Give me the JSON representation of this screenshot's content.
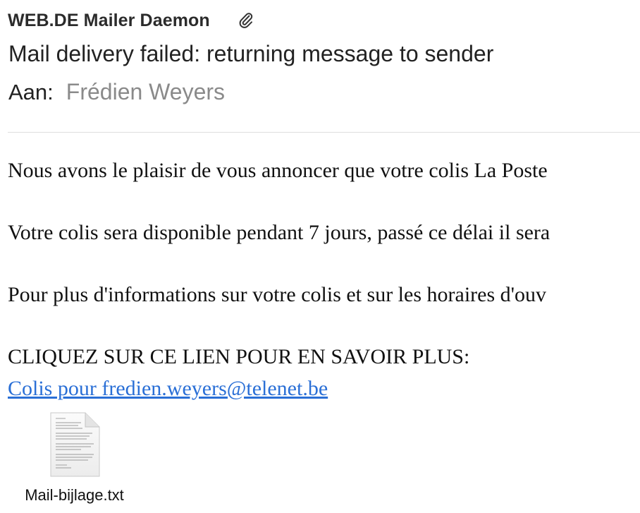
{
  "header": {
    "sender": "WEB.DE Mailer Daemon",
    "attachment_icon": "paperclip-icon",
    "subject": "Mail delivery failed: returning message to sender",
    "to_label": "Aan:",
    "to_value": "Frédien Weyers"
  },
  "body": {
    "paragraphs": [
      "Nous avons le plaisir de vous annoncer que votre colis La Poste",
      "Votre colis sera disponible pendant 7 jours, passé ce délai il sera",
      "Pour plus d'informations sur votre colis et sur les horaires d'ouv",
      "CLIQUEZ SUR CE LIEN POUR EN SAVOIR PLUS:"
    ],
    "link_text": "Colis pour fredien.weyers@telenet.be",
    "link_color": "#2a6fd6"
  },
  "attachment": {
    "icon": "text-file-icon",
    "filename": "Mail-bijlage.txt"
  }
}
